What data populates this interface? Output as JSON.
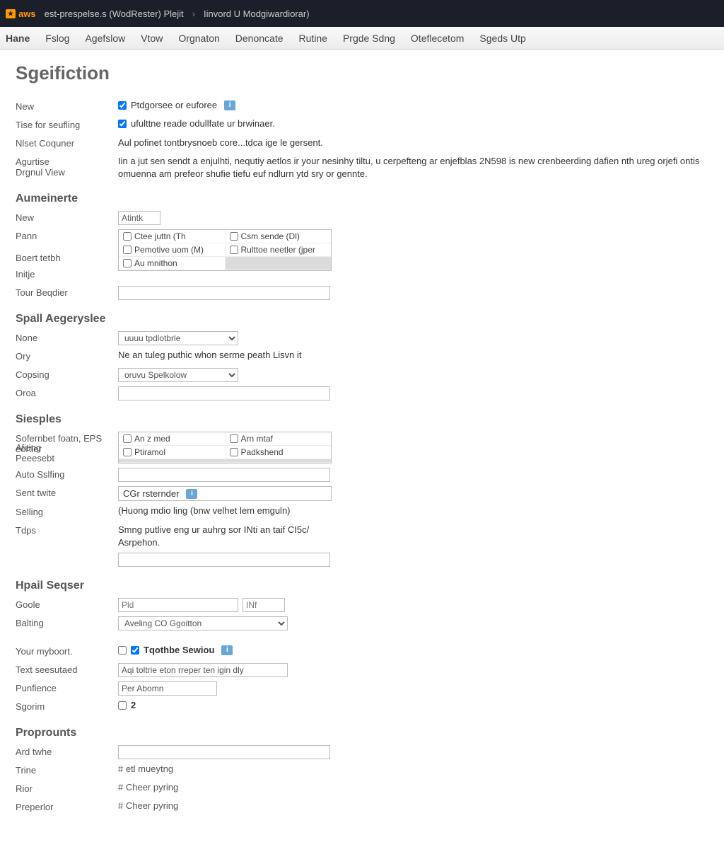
{
  "topbar": {
    "logo_text": "aws",
    "crumb1": "est-prespelse.s (WodRester) Plejit",
    "sep": "›",
    "crumb2": "Iinvord U Modgiwardiorar)"
  },
  "nav": {
    "items": [
      "Hane",
      "Fslog",
      "Agefslow",
      "Vtow",
      "Orgnaton",
      "Denoncate",
      "Rutine",
      "Prgde Sdng",
      "Oteflecetom",
      "Sgeds Utp"
    ]
  },
  "page_title": "Sgeifiction",
  "sec_top": {
    "new_label": "New",
    "new_value": "Ptdgorsee or euforee",
    "tise_label": "Tise for seufling",
    "tise_value": "ufulttne reade odullfate ur brwinaer.",
    "nlset_label": "Nlset Coquner",
    "nlset_value": "Aul pofinet tontbrysnoeb core...tdca ige le gersent.",
    "agar_label": "Agurtise",
    "drgn_label": "Drgnul View",
    "long_value": "Iin a jut sen sendt a enjulhti, nequtiy aetlos ir your nesinhy tiltu, u cerpefteng ar enjefblas 2N598 is new crenbeerding dafien nth ureg orjefi ontis omuenna am prefeor shufie tiefu euf ndlurn ytd sry or gennte."
  },
  "aumeinerte": {
    "heading": "Aumeinerte",
    "new_label": "New",
    "new_input": "Atintk",
    "pann_label": "Pann",
    "grid": [
      [
        "Ctee juttn (Th",
        "Csm sende (Dl)"
      ],
      [
        "Pemotive uom (M)",
        "Rulttoe neetler (jper"
      ],
      [
        "Au mnithon",
        ""
      ]
    ],
    "boert_label": "Boert tetbh",
    "initje_label": "Initje",
    "tour_label": "Tour Beqdier"
  },
  "spall": {
    "heading": "Spall Aegeryslee",
    "none_label": "None",
    "none_value": "uuuu tpdlotbrle",
    "ory_label": "Ory",
    "ory_text": "Ne an tuleg puthic whon serme peath Lisvn it",
    "copsing_label": "Copsing",
    "copsing_value": "oruvu Spelkolow",
    "oroa_label": "Oroa"
  },
  "siesples": {
    "heading": "Siesples",
    "sofern_label": "Sofernbet foatn, EPS eortier",
    "grid": [
      [
        "An z med",
        "Arn mtaf"
      ],
      [
        "Ptiramol",
        "Padkshend"
      ]
    ],
    "afiting_label": "Afiting",
    "peeesebt_label": "Peeesebt",
    "auto_label": "Auto Sslfing",
    "sent_label": "Sent twite",
    "sent_value": "CGr rsternder",
    "selling_label": "Selling",
    "selling_text": "(Huong mdio ling (bnw velhet lem emguln)",
    "tdps_label": "Tdps",
    "tdps_text": "Smng putlive eng ur auhrg sor INti an taif CI5c/ Asrpehon."
  },
  "hpail": {
    "heading": "Hpail Seqser",
    "goole_label": "Goole",
    "goole_ph1": "Pld",
    "goole_ph2": "INf",
    "balng_label": "Balting",
    "balng_value": "Aveling CO Ggoitton"
  },
  "your": {
    "your_label": "Your myboort.",
    "your_value": "Tqothbe Sewiou",
    "text_label": "Text seesutaed",
    "text_value": "Aqi toltrie eton rreper ten igin dly",
    "pun_label": "Punfience",
    "pun_value": "Per Abomn",
    "sgn_label": "Sgorim",
    "sgn_value": "2"
  },
  "proprounts": {
    "heading": "Proprounts",
    "ard_label": "Ard twhe",
    "trine_label": "Trine",
    "trine_hash": "# etl mueytng",
    "rior_label": "Rior",
    "rior_hash": "# Cheer pyring",
    "pre_label": "Preperlor",
    "pre_hash": "# Cheer pyring"
  }
}
